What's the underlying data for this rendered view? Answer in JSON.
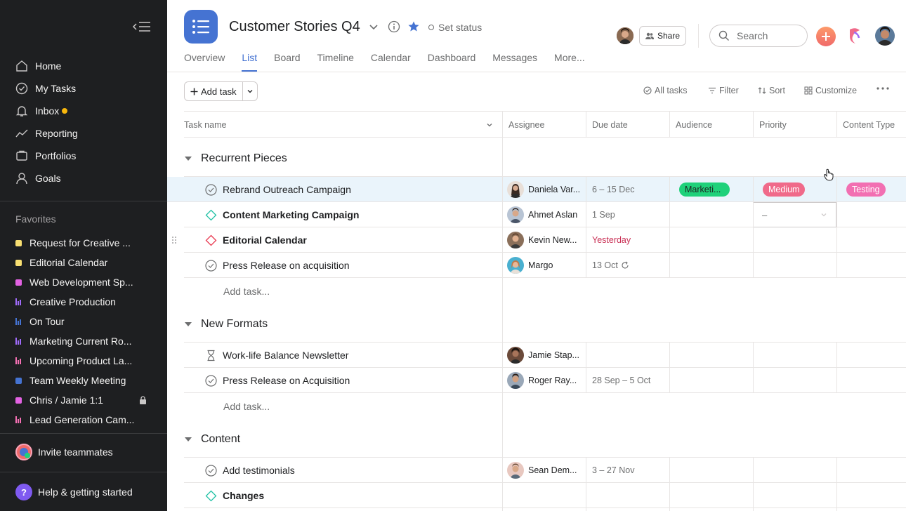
{
  "sidebar": {
    "nav": [
      {
        "label": "Home",
        "icon": "home-icon"
      },
      {
        "label": "My Tasks",
        "icon": "check-circle-icon"
      },
      {
        "label": "Inbox",
        "icon": "bell-icon",
        "dot_color": "#f8b70c"
      },
      {
        "label": "Reporting",
        "icon": "trend-line-icon"
      },
      {
        "label": "Portfolios",
        "icon": "folder-icon"
      },
      {
        "label": "Goals",
        "icon": "person-icon"
      }
    ],
    "favorites_title": "Favorites",
    "favorites": [
      {
        "label": "Request for Creative ...",
        "type": "square",
        "color": "#f8df72"
      },
      {
        "label": "Editorial Calendar",
        "type": "square",
        "color": "#f8df72"
      },
      {
        "label": "Web Development Sp...",
        "type": "square",
        "color": "#e362e3"
      },
      {
        "label": "Creative Production",
        "type": "bars",
        "color": "#9e6af8"
      },
      {
        "label": "On Tour",
        "type": "bars",
        "color": "#4573d2"
      },
      {
        "label": "Marketing Current Ro...",
        "type": "bars",
        "color": "#9e6af8"
      },
      {
        "label": "Upcoming Product La...",
        "type": "bars",
        "color": "#f26fb2"
      },
      {
        "label": "Team Weekly Meeting",
        "type": "square",
        "color": "#4573d2"
      },
      {
        "label": "Chris / Jamie 1:1",
        "type": "square",
        "color": "#e362e3",
        "locked": true
      },
      {
        "label": "Lead Generation Cam...",
        "type": "bars",
        "color": "#f26fb2"
      }
    ],
    "invite_label": "Invite teammates",
    "help_label": "Help & getting started"
  },
  "header": {
    "project_title": "Customer Stories Q4",
    "set_status": "Set status",
    "share_label": "Share",
    "search_placeholder": "Search",
    "tabs": [
      "Overview",
      "List",
      "Board",
      "Timeline",
      "Calendar",
      "Dashboard",
      "Messages",
      "More..."
    ],
    "active_tab": "List"
  },
  "toolbar": {
    "add_task": "Add task",
    "all_tasks": "All tasks",
    "filter": "Filter",
    "sort": "Sort",
    "customize": "Customize"
  },
  "table": {
    "columns": [
      "Task name",
      "Assignee",
      "Due date",
      "Audience",
      "Priority",
      "Content Type"
    ],
    "add_task_link": "Add task...",
    "sections": [
      {
        "title": "Recurrent Pieces"
      },
      {
        "title": "New Formats"
      },
      {
        "title": "Content"
      }
    ],
    "rows": [
      {
        "name": "Rebrand Outreach Campaign",
        "assignee": "Daniela Var...",
        "due": "6 – 15 Dec",
        "audience": "Marketi...",
        "priority": "Medium",
        "content_type": "Testing"
      },
      {
        "name": "Content Marketing Campaign",
        "assignee": "Ahmet Aslan",
        "due": "1 Sep",
        "priority_placeholder": "–"
      },
      {
        "name": "Editorial Calendar",
        "assignee": "Kevin New...",
        "due": "Yesterday"
      },
      {
        "name": "Press Release on acquisition",
        "assignee": "Margo",
        "due": "13 Oct"
      },
      {
        "name": "Work-life Balance Newsletter",
        "assignee": "Jamie Stap...",
        "due": ""
      },
      {
        "name": "Press Release on Acquisition",
        "assignee": "Roger Ray...",
        "due": "28 Sep – 5 Oct"
      },
      {
        "name": "Add testimonials",
        "assignee": "Sean Dem...",
        "due": "3 – 27 Nov"
      },
      {
        "name": "Changes",
        "assignee": "",
        "due": ""
      }
    ]
  },
  "colors": {
    "audience_pill": "#1fd17a",
    "priority_pill": "#f06a8a",
    "content_type_pill": "#f26fb2",
    "accent": "#4573d2",
    "overdue": "#c92f54"
  }
}
